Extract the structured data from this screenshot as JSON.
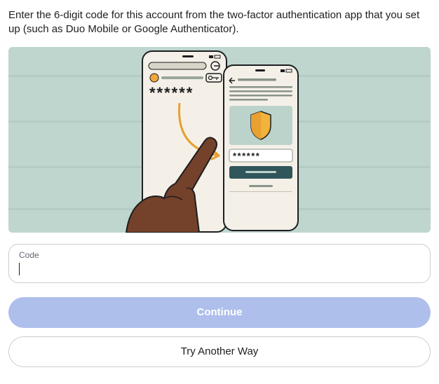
{
  "instructions": "Enter the 6-digit code for this account from the two-factor authentication app that you set up (such as Duo Mobile or Google Authenticator).",
  "field": {
    "label": "Code",
    "value": "",
    "placeholder": ""
  },
  "buttons": {
    "continue": "Continue",
    "try_another": "Try Another Way"
  },
  "illustration": {
    "left_code": "******",
    "right_code": "******",
    "icon": "shield-icon"
  },
  "colors": {
    "primary_button": "#aebfec",
    "border": "#c9ccd1",
    "bg_illustration": "#bfd6ce"
  }
}
